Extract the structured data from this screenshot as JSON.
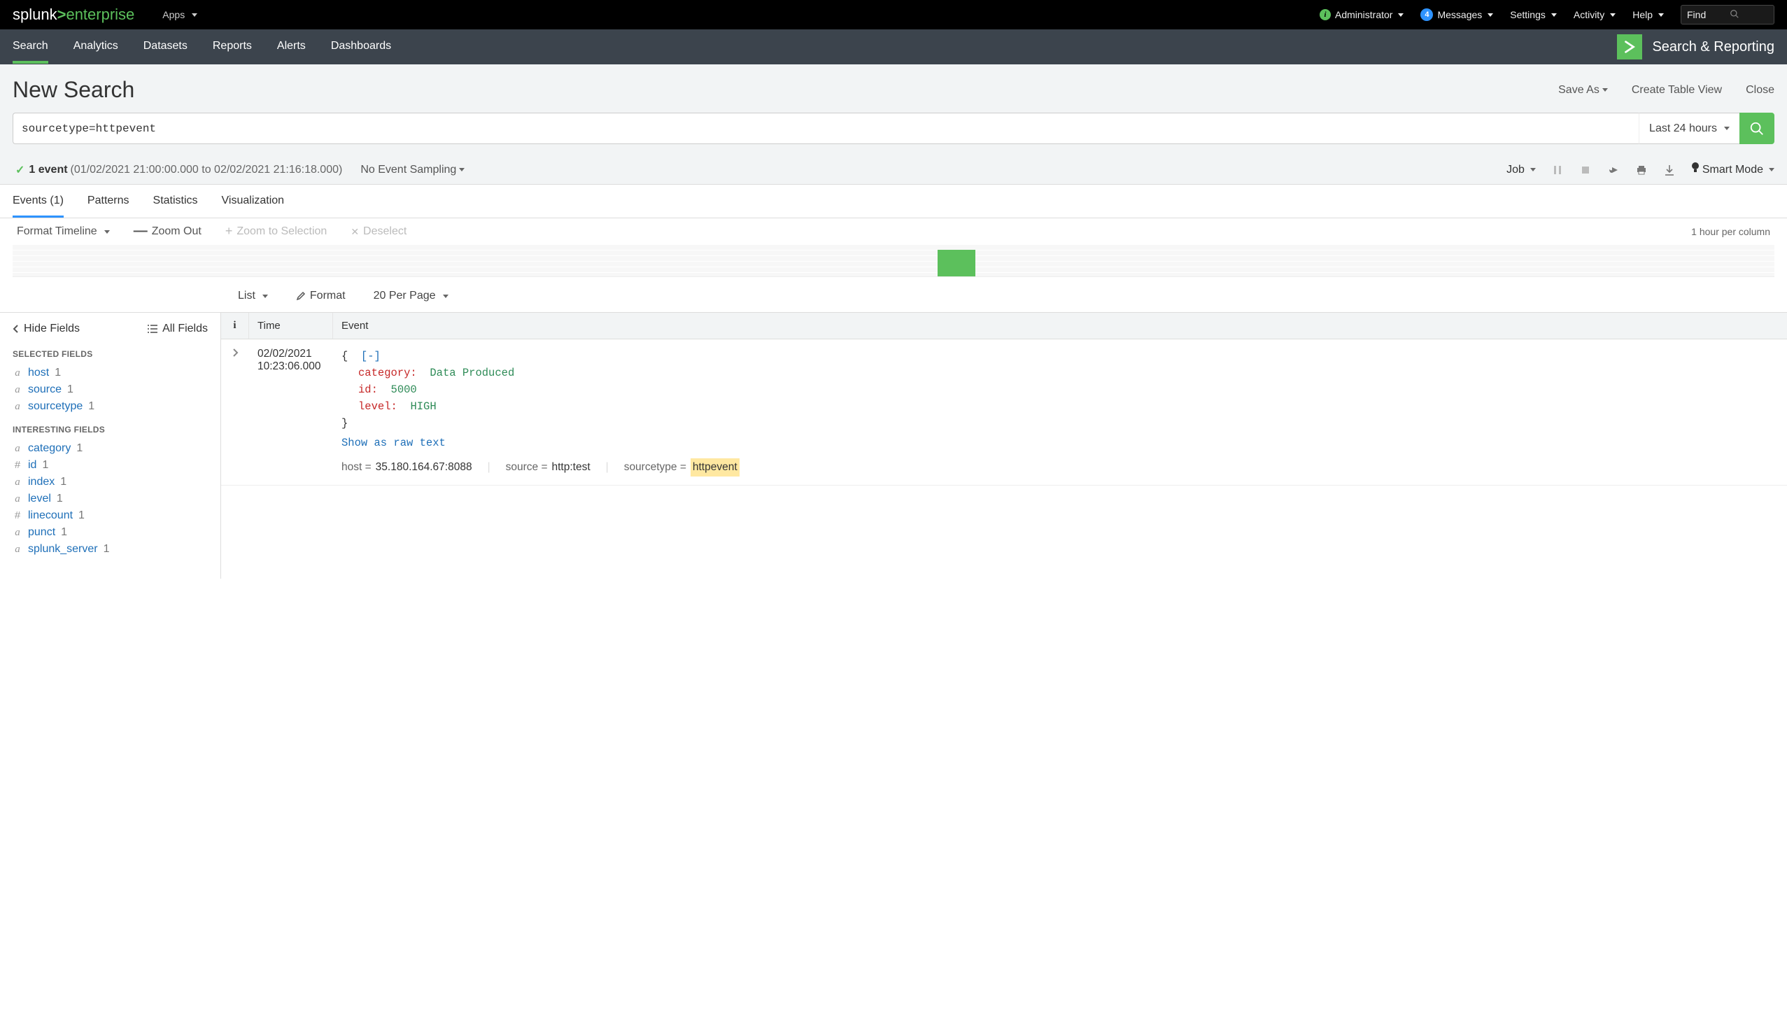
{
  "topbar": {
    "logo_pre": "splunk",
    "logo_gt": ">",
    "logo_ent": "enterprise",
    "apps": "Apps",
    "admin": "Administrator",
    "messages": "Messages",
    "messages_count": "4",
    "settings": "Settings",
    "activity": "Activity",
    "help": "Help",
    "find_placeholder": "Find"
  },
  "appbar": {
    "tabs": [
      "Search",
      "Analytics",
      "Datasets",
      "Reports",
      "Alerts",
      "Dashboards"
    ],
    "app_title": "Search & Reporting"
  },
  "page": {
    "title": "New Search",
    "save_as": "Save As",
    "create_table": "Create Table View",
    "close": "Close"
  },
  "search": {
    "query": "sourcetype=httpevent",
    "time_label": "Last 24 hours"
  },
  "status": {
    "event_count": "1 event",
    "time_range": "(01/02/2021 21:00:00.000 to 02/02/2021 21:16:18.000)",
    "sampling": "No Event Sampling",
    "job": "Job",
    "smart_mode": "Smart Mode"
  },
  "result_tabs": {
    "events": "Events (1)",
    "patterns": "Patterns",
    "statistics": "Statistics",
    "visualization": "Visualization"
  },
  "timeline_ctrl": {
    "format": "Format Timeline",
    "zoom_out": "Zoom Out",
    "zoom_sel": "Zoom to Selection",
    "deselect": "Deselect",
    "per_col": "1 hour per column"
  },
  "list_ctrl": {
    "list": "List",
    "format": "Format",
    "per_page": "20 Per Page"
  },
  "fields": {
    "hide": "Hide Fields",
    "all": "All Fields",
    "selected_label": "SELECTED FIELDS",
    "selected": [
      {
        "type": "a",
        "name": "host",
        "count": "1"
      },
      {
        "type": "a",
        "name": "source",
        "count": "1"
      },
      {
        "type": "a",
        "name": "sourcetype",
        "count": "1"
      }
    ],
    "interesting_label": "INTERESTING FIELDS",
    "interesting": [
      {
        "type": "a",
        "name": "category",
        "count": "1"
      },
      {
        "type": "#",
        "name": "id",
        "count": "1"
      },
      {
        "type": "a",
        "name": "index",
        "count": "1"
      },
      {
        "type": "a",
        "name": "level",
        "count": "1"
      },
      {
        "type": "#",
        "name": "linecount",
        "count": "1"
      },
      {
        "type": "a",
        "name": "punct",
        "count": "1"
      },
      {
        "type": "a",
        "name": "splunk_server",
        "count": "1"
      }
    ]
  },
  "events_table": {
    "col_i": "i",
    "col_time": "Time",
    "col_event": "Event"
  },
  "event": {
    "date": "02/02/2021",
    "time": "10:23:06.000",
    "collapse": "[-]",
    "brace_open": "{",
    "brace_close": "}",
    "k_category": "category",
    "v_category": "Data Produced",
    "k_id": "id",
    "v_id": "5000",
    "k_level": "level",
    "v_level": "HIGH",
    "raw_link": "Show as raw text",
    "meta_host_k": "host =",
    "meta_host_v": "35.180.164.67:8088",
    "meta_source_k": "source =",
    "meta_source_v": "http:test",
    "meta_st_k": "sourcetype =",
    "meta_st_v": "httpevent"
  }
}
